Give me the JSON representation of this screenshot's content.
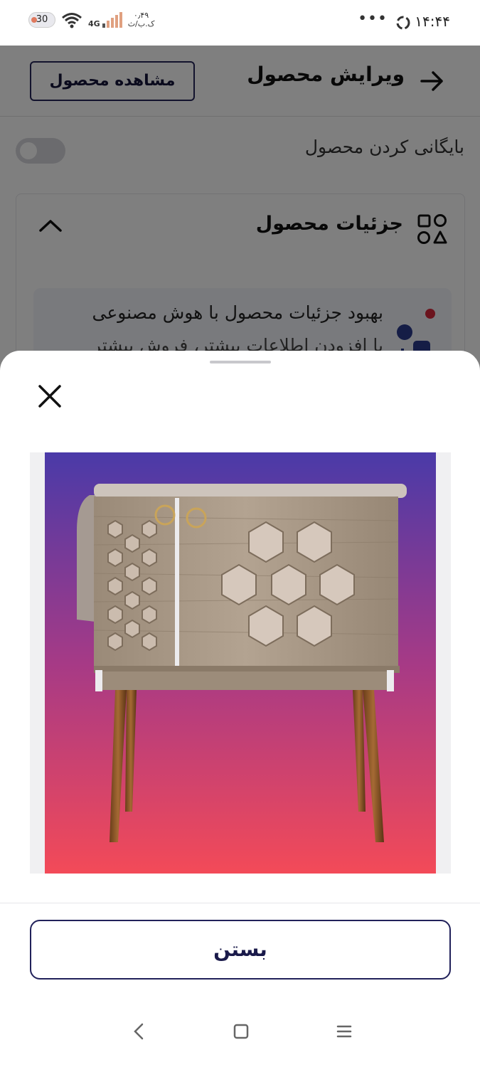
{
  "status_bar": {
    "time": "۱۴:۴۴",
    "battery": "30",
    "network": "4G",
    "speed_value": "۰٫۴۹",
    "speed_unit": "ک.ب/ث"
  },
  "header": {
    "title": "ویرایش محصول",
    "view_button": "مشاهده محصول"
  },
  "archive": {
    "label": "بایگانی کردن محصول",
    "enabled": false
  },
  "details": {
    "title": "جزئیات محصول",
    "ai_title": "بهبود جزئیات محصول با هوش مصنوعی",
    "ai_subtitle": "با افزودن اطلاعات بیشتر، فروش بیشتر"
  },
  "sheet": {
    "image_alt": "کمد چوبی با طرح شش‌ضلعی",
    "close_button": "بستن"
  },
  "colors": {
    "accent": "#21215a",
    "image_gradient_top": "#4a3aa8",
    "image_gradient_bottom": "#f34a58"
  }
}
